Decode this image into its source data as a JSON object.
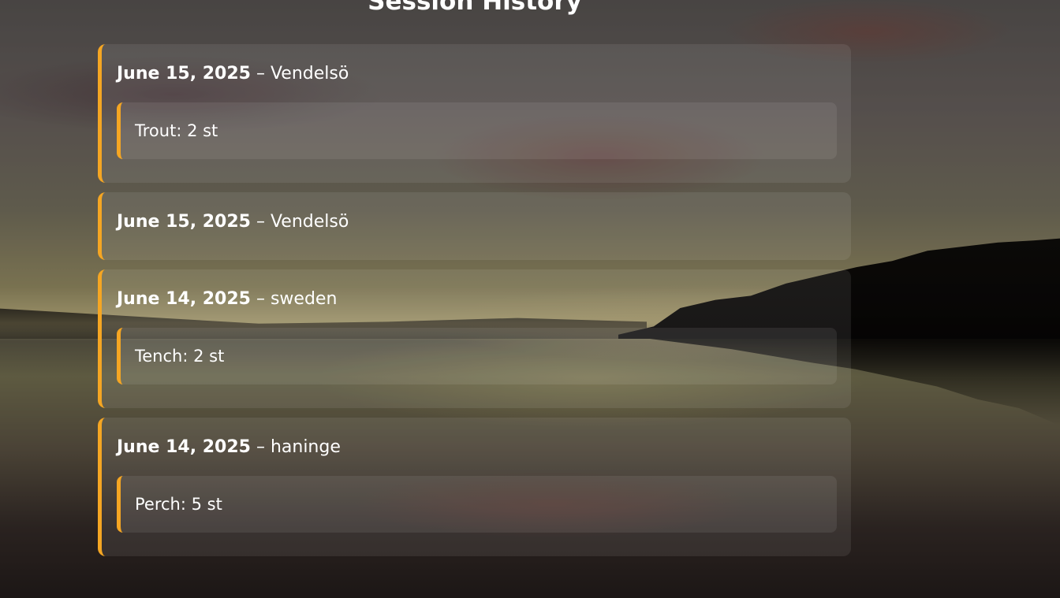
{
  "page": {
    "title": "Session History"
  },
  "sessions": [
    {
      "date": "June 15, 2025",
      "separator": "–",
      "location": "Vendelsö",
      "catches": [
        {
          "species": "Trout",
          "count": "2 st"
        }
      ]
    },
    {
      "date": "June 15, 2025",
      "separator": "–",
      "location": "Vendelsö",
      "catches": []
    },
    {
      "date": "June 14, 2025",
      "separator": "–",
      "location": "sweden",
      "catches": [
        {
          "species": "Tench",
          "count": "2 st"
        }
      ]
    },
    {
      "date": "June 14, 2025",
      "separator": "–",
      "location": "haninge",
      "catches": [
        {
          "species": "Perch",
          "count": "5 st"
        }
      ]
    }
  ],
  "colors": {
    "accent": "#f5a623",
    "text": "#ffffff"
  }
}
